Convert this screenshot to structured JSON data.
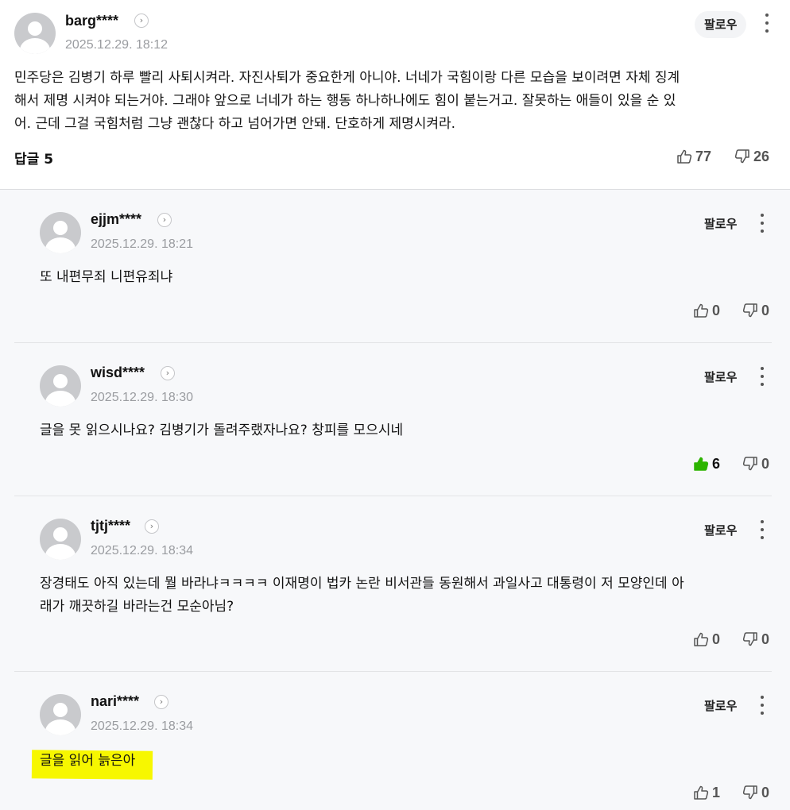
{
  "main_comment": {
    "username": "barg****",
    "date": "2025.12.29. 18:12",
    "follow_label": "팔로우",
    "text_lines": [
      "민주당은 김병기 하루 빨리 사퇴시켜라. 자진사퇴가 중요한게 아니야. 너네가 국힘이랑 다른 모습을 보이려면 자체 징계",
      "해서 제명 시켜야 되는거야. 그래야 앞으로 너네가 하는 행동 하나하나에도 힘이 붙는거고. 잘못하는 애들이 있을 순 있",
      "어. 근데 그걸 국힘처럼 그냥 괜찮다 하고 넘어가면 안돼. 단호하게 제명시켜라."
    ],
    "reply_label": "답글 5",
    "likes": "77",
    "dislikes": "26"
  },
  "replies": [
    {
      "username": "ejjm****",
      "date": "2025.12.29. 18:21",
      "follow_label": "팔로우",
      "text_lines": [
        "또 내편무죄 니편유죄냐"
      ],
      "likes": "0",
      "dislikes": "0",
      "liked": false
    },
    {
      "username": "wisd****",
      "date": "2025.12.29. 18:30",
      "follow_label": "팔로우",
      "text_lines": [
        "글을 못 읽으시나요? 김병기가 돌려주랬자나요? 창피를 모으시네"
      ],
      "likes": "6",
      "dislikes": "0",
      "liked": true
    },
    {
      "username": "tjtj****",
      "date": "2025.12.29. 18:34",
      "follow_label": "팔로우",
      "text_lines": [
        "장경태도 아직 있는데 뭘 바라냐ㅋㅋㅋㅋ 이재명이 법카 논란 비서관들 동원해서 과일사고 대통령이 저 모양인데 아",
        "래가 깨끗하길 바라는건 모순아님?"
      ],
      "likes": "0",
      "dislikes": "0",
      "liked": false
    },
    {
      "username": "nari****",
      "date": "2025.12.29. 18:34",
      "follow_label": "팔로우",
      "text_lines": [
        "글을 읽어 늙은아"
      ],
      "likes": "1",
      "dislikes": "0",
      "liked": false
    }
  ],
  "colors": {
    "like_active": "#2db400",
    "highlight": "#f7f700",
    "muted_text": "#9a9ca0"
  }
}
